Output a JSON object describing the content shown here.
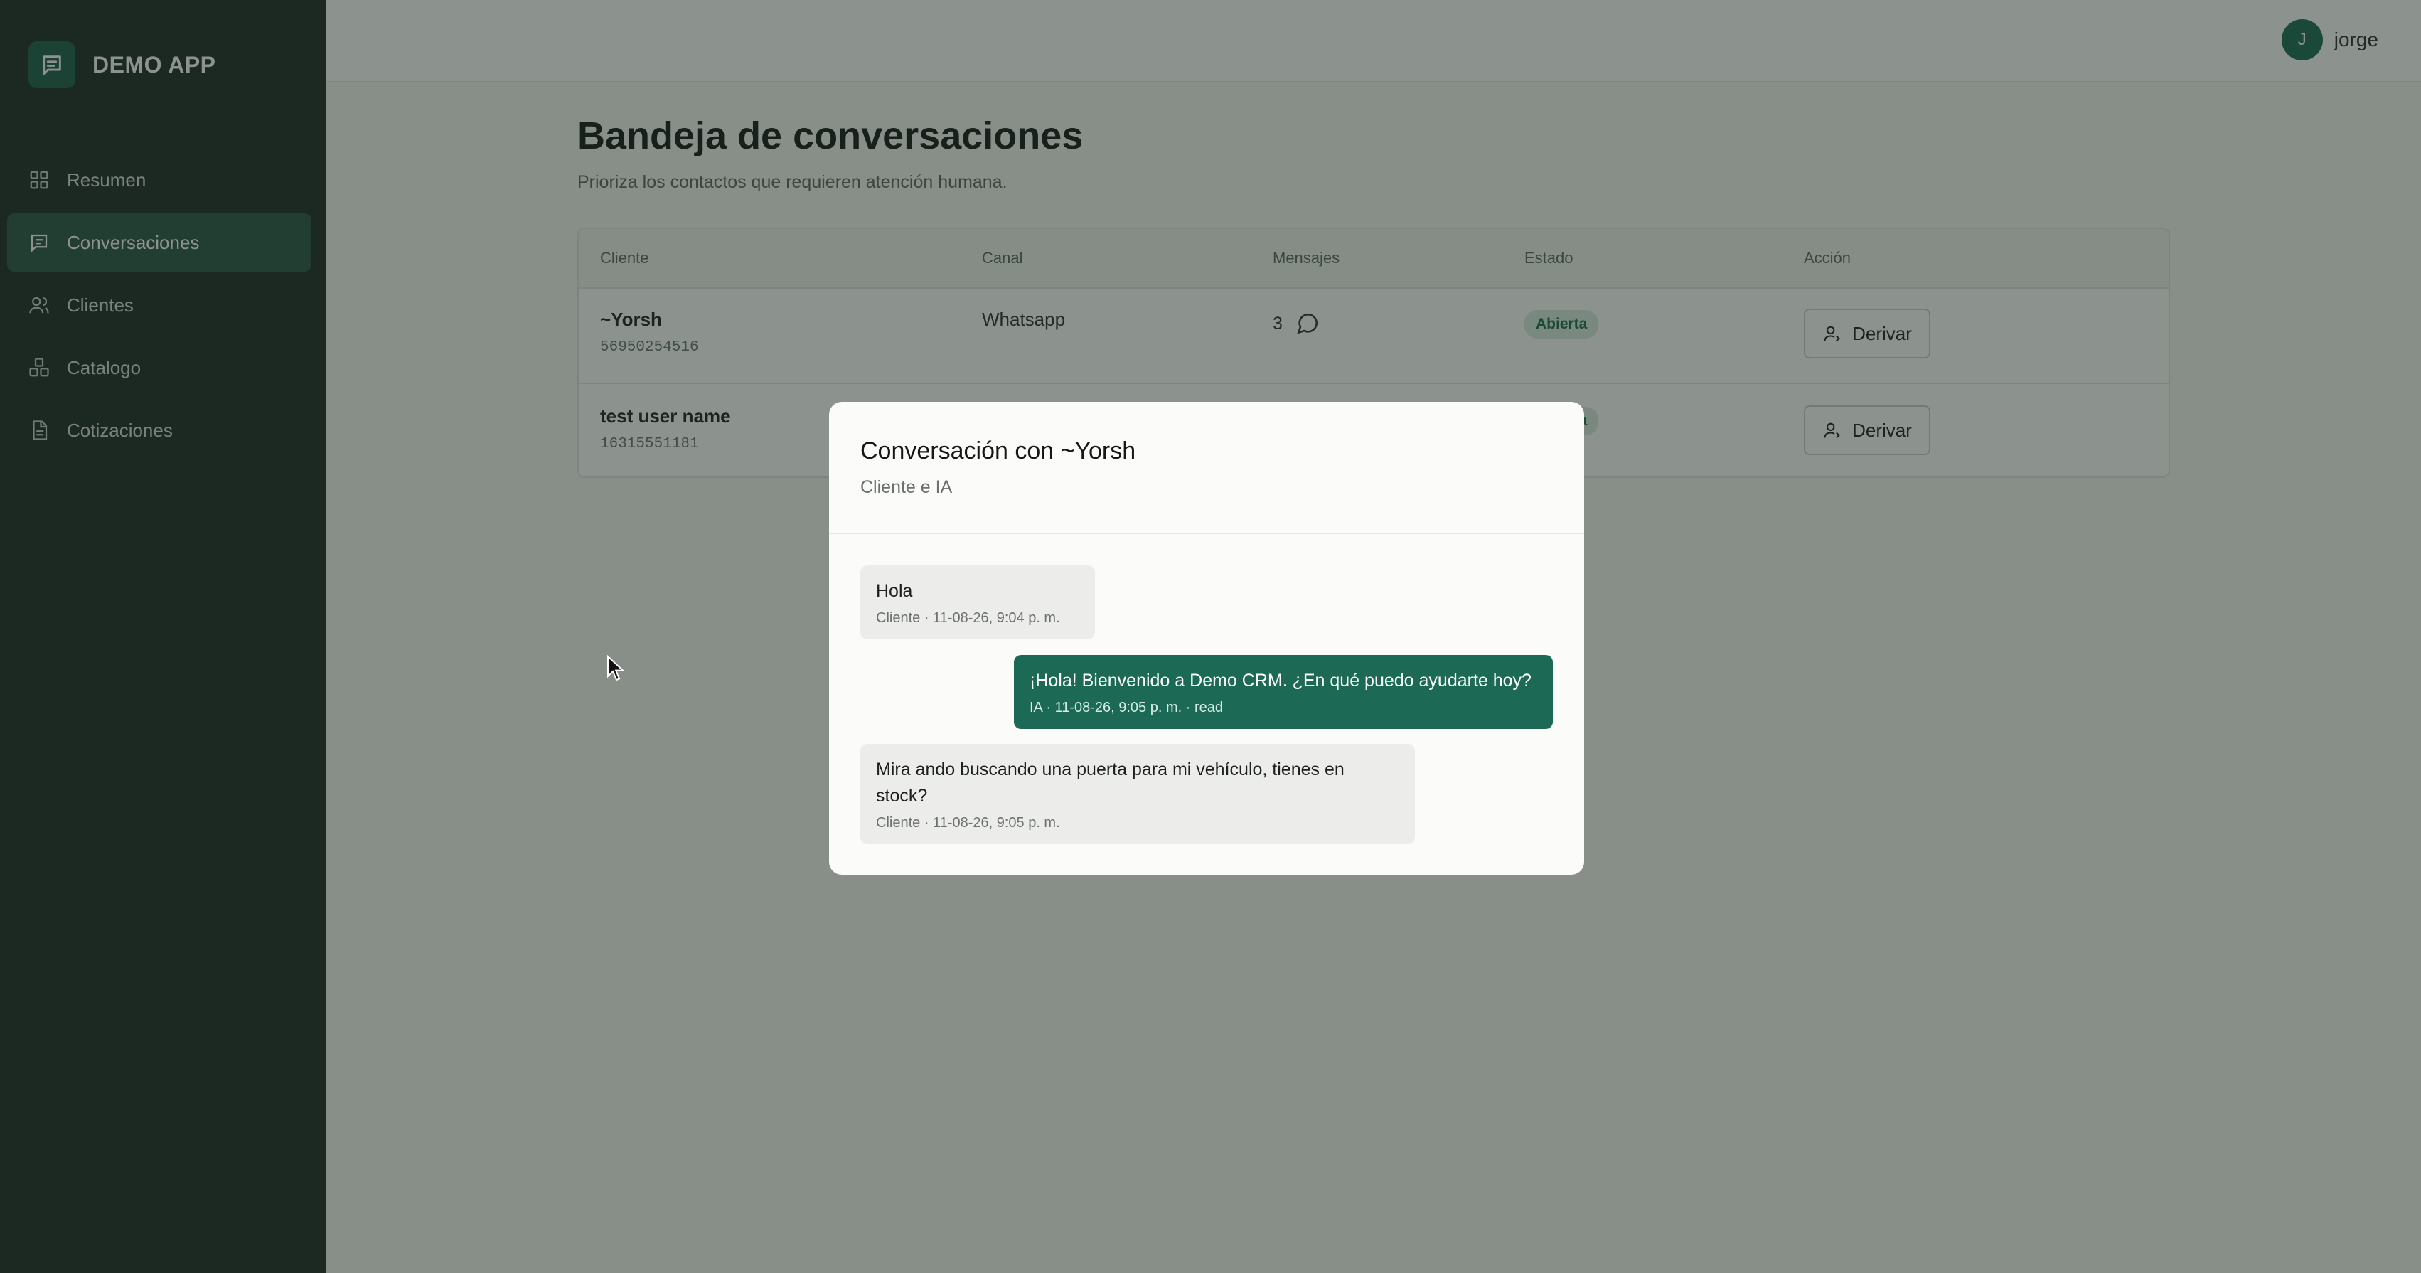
{
  "app": {
    "name": "DEMO APP"
  },
  "sidebar": {
    "items": [
      {
        "label": "Resumen",
        "icon": "grid-icon",
        "active": false
      },
      {
        "label": "Conversaciones",
        "icon": "message-square-icon",
        "active": true
      },
      {
        "label": "Clientes",
        "icon": "users-icon",
        "active": false
      },
      {
        "label": "Catalogo",
        "icon": "boxes-icon",
        "active": false
      },
      {
        "label": "Cotizaciones",
        "icon": "file-text-icon",
        "active": false
      }
    ]
  },
  "topbar": {
    "user": {
      "initial": "J",
      "name": "jorge"
    }
  },
  "page": {
    "title": "Bandeja de conversaciones",
    "subtitle": "Prioriza los contactos que requieren atención humana."
  },
  "table": {
    "headers": [
      "Cliente",
      "Canal",
      "Mensajes",
      "Estado",
      "Acción"
    ],
    "rows": [
      {
        "name": "~Yorsh",
        "phone": "56950254516",
        "channel": "Whatsapp",
        "messages": "3",
        "status": "Abierta",
        "action": "Derivar"
      },
      {
        "name": "test user name",
        "phone": "16315551181",
        "channel": "",
        "messages": "",
        "status": "Abierta",
        "action": "Derivar"
      }
    ]
  },
  "modal": {
    "title": "Conversación con ~Yorsh",
    "subtitle": "Cliente e IA",
    "messages": [
      {
        "from": "client",
        "text": "Hola",
        "meta": "Cliente · 11-08-26, 9:04 p. m."
      },
      {
        "from": "ai",
        "text": "¡Hola! Bienvenido a Demo CRM. ¿En qué puedo ayudarte hoy?",
        "meta": "IA · 11-08-26, 9:05 p. m. · read"
      },
      {
        "from": "client",
        "text": "Mira ando buscando una puerta para mi vehículo, tienes en stock?",
        "meta": "Cliente · 11-08-26, 9:05 p. m."
      }
    ]
  },
  "colors": {
    "accent": "#1c6a55",
    "sidebar_bg": "#1f2a27",
    "active_item": "#2b5246",
    "badge_bg": "#d8ebe2"
  }
}
